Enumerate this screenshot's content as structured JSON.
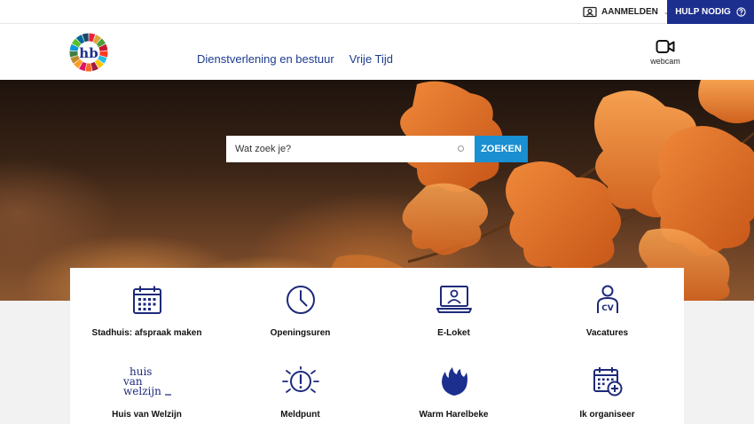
{
  "topbar": {
    "login_label": "AANMELDEN",
    "help_label": "HULP NODIG"
  },
  "header": {
    "logo_alt": "hb",
    "nav": [
      {
        "label": "Dienstverlening en bestuur"
      },
      {
        "label": "Vrije Tijd"
      }
    ],
    "webcam_label": "webcam"
  },
  "search": {
    "placeholder": "Wat zoek je?",
    "button_label": "ZOEKEN"
  },
  "tiles": [
    {
      "label": "Stadhuis: afspraak maken",
      "icon": "calendar-icon"
    },
    {
      "label": "Openingsuren",
      "icon": "clock-icon"
    },
    {
      "label": "E-Loket",
      "icon": "laptop-user-icon"
    },
    {
      "label": "Vacatures",
      "icon": "cv-person-icon"
    },
    {
      "label": "Huis van Welzijn",
      "icon": "huis-van-welzijn-logo",
      "logo_text": [
        "huis",
        "van",
        "welzijn"
      ]
    },
    {
      "label": "Meldpunt",
      "icon": "alert-icon"
    },
    {
      "label": "Warm Harelbeke",
      "icon": "flame-icon"
    },
    {
      "label": "Ik organiseer",
      "icon": "calendar-add-icon"
    }
  ],
  "colors": {
    "brand_blue": "#1d2f8e",
    "search_button": "#1a8fd1",
    "icon_blue": "#1d2a7a"
  }
}
